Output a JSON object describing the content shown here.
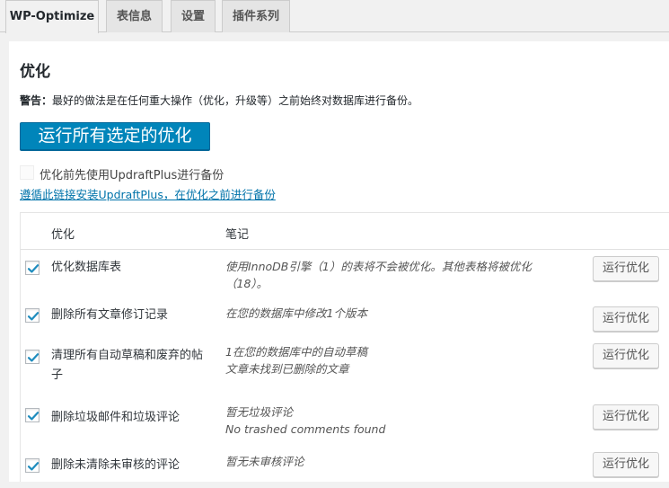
{
  "tabs": [
    {
      "label": "WP-Optimize",
      "active": true
    },
    {
      "label": "表信息",
      "active": false
    },
    {
      "label": "设置",
      "active": false
    },
    {
      "label": "插件系列",
      "active": false
    }
  ],
  "page": {
    "title": "优化",
    "warning_prefix": "警告：",
    "warning_text": "最好的做法是在任何重大操作（优化，升级等）之前始终对数据库进行备份。",
    "run_all_label": "运行所有选定的优化",
    "backup_checkbox_label": "优化前先使用UpdraftPlus进行备份",
    "backup_checked": false,
    "backup_link": "遵循此链接安装UpdraftPlus，在优化之前进行备份"
  },
  "table": {
    "headers": {
      "optimization": "优化",
      "notes": "笔记"
    },
    "rows": [
      {
        "checked": true,
        "name": "优化数据库表",
        "note_lines": [
          "使用InnoDB引擎（1）的表将不会被优化。其他表格将被优化",
          "（18）。"
        ],
        "button": "运行优化"
      },
      {
        "checked": true,
        "name": "删除所有文章修订记录",
        "note_lines": [
          "在您的数据库中修改1个版本"
        ],
        "button": "运行优化"
      },
      {
        "checked": true,
        "name": "清理所有自动草稿和废弃的帖子",
        "note_lines": [
          "1在您的数据库中的自动草稿",
          "文章未找到已删除的文章"
        ],
        "button": "运行优化"
      },
      {
        "checked": true,
        "name": "删除垃圾邮件和垃圾评论",
        "note_lines": [
          "暂无垃圾评论",
          "No trashed comments found"
        ],
        "button": "运行优化"
      },
      {
        "checked": true,
        "name": "删除未清除未审核的评论",
        "note_lines": [
          "暂无未审核评论"
        ],
        "button": "运行优化"
      }
    ]
  },
  "colors": {
    "primary": "#0085ba",
    "link": "#0073aa",
    "checkmark": "#1e8cbe"
  }
}
